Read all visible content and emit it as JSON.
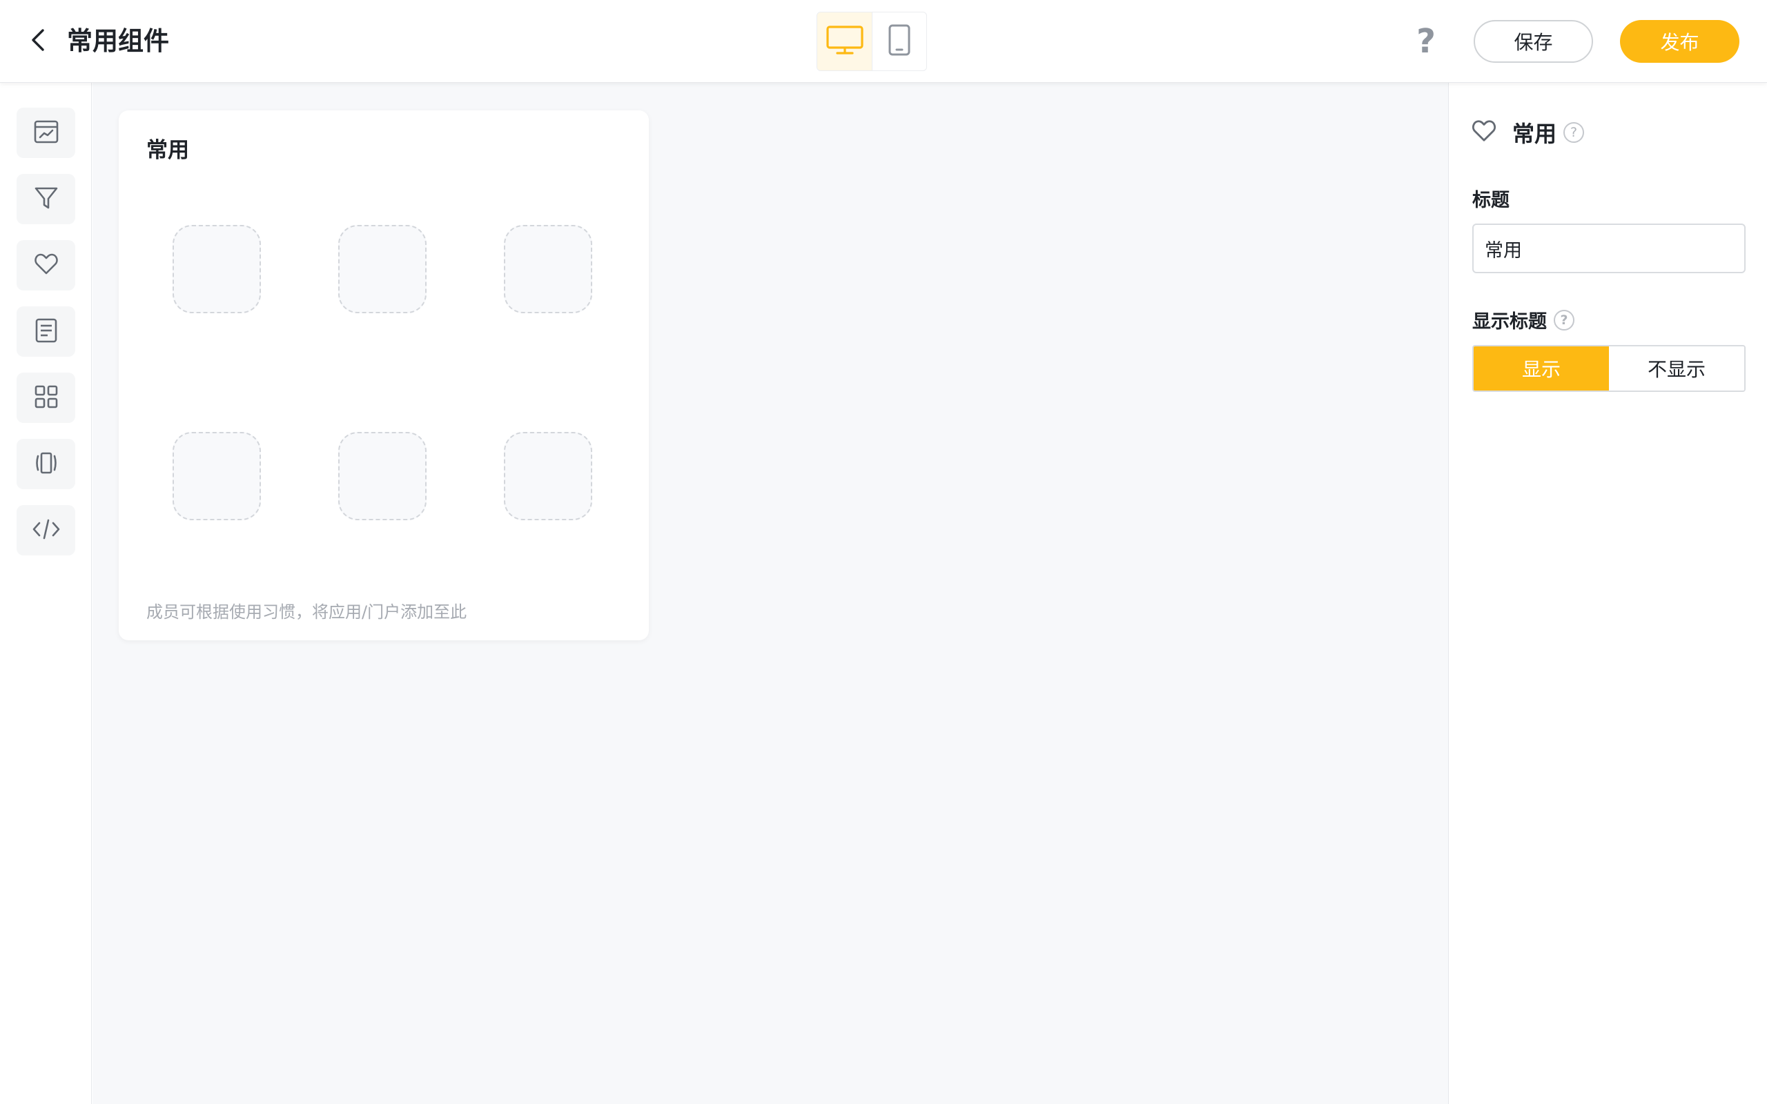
{
  "header": {
    "back_icon": "chevron-left-icon",
    "title": "常用组件",
    "devices": [
      {
        "name": "desktop",
        "icon": "monitor-icon",
        "active": true
      },
      {
        "name": "mobile",
        "icon": "phone-icon",
        "active": false
      }
    ],
    "help_label": "?",
    "save_label": "保存",
    "publish_label": "发布"
  },
  "toolbar": {
    "items": [
      {
        "name": "chart",
        "icon": "chart-card-icon"
      },
      {
        "name": "filter",
        "icon": "filter-icon"
      },
      {
        "name": "favorite",
        "icon": "heart-icon"
      },
      {
        "name": "document",
        "icon": "document-icon"
      },
      {
        "name": "apps",
        "icon": "grid-icon"
      },
      {
        "name": "carousel",
        "icon": "carousel-icon"
      },
      {
        "name": "embed",
        "icon": "code-icon"
      }
    ]
  },
  "widget": {
    "title": "常用",
    "slots": 6,
    "hint": "成员可根据使用习惯，将应用/门户添加至此"
  },
  "panel": {
    "icon": "heart-icon",
    "title": "常用",
    "help_icon": "?",
    "title_field_label": "标题",
    "title_field_value": "常用",
    "show_title_label": "显示标题",
    "show_title_help": "?",
    "show_title_options": [
      "显示",
      "不显示"
    ],
    "show_title_selected": "显示"
  },
  "colors": {
    "accent": "#fdb913",
    "canvas_bg": "#f7f8fa",
    "border": "#e6e8eb"
  }
}
